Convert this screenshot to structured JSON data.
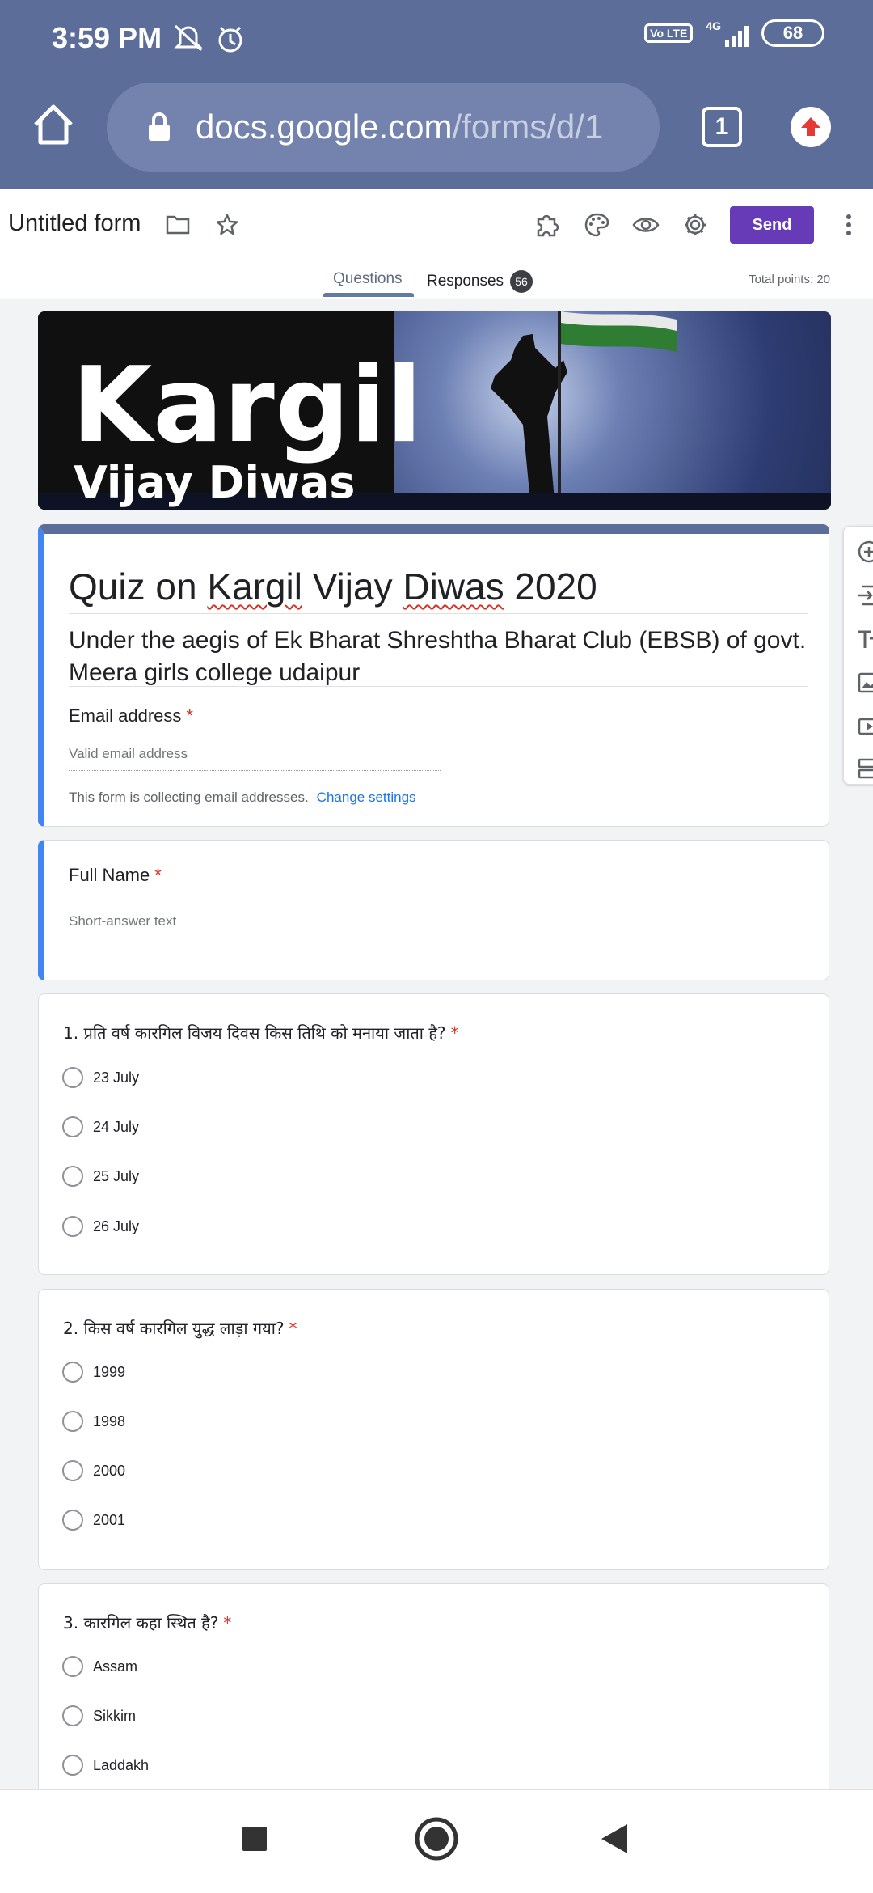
{
  "status": {
    "time": "3:59 PM",
    "network": "4G",
    "volte": "Vo LTE",
    "battery": "68"
  },
  "browser": {
    "url_host": "docs.google.com",
    "url_path": "/forms/d/1",
    "tab_count": "1"
  },
  "form_header": {
    "title": "Untitled form",
    "send_label": "Send",
    "tabs": [
      {
        "label": "Questions"
      },
      {
        "label": "Responses",
        "badge": "56"
      }
    ],
    "total_points": "Total points: 20"
  },
  "banner": {
    "title": "Kargil",
    "subtitle": "Vijay Diwas"
  },
  "form": {
    "title_parts": [
      "Quiz on ",
      "Kargil",
      " Vijay ",
      "Diwas",
      " 2020"
    ],
    "description": "Under the aegis of Ek Bharat Shreshtha Bharat Club (EBSB) of govt. Meera girls college udaipur",
    "email_label": "Email address",
    "email_placeholder": "Valid email address",
    "collect_note": "This form is collecting email addresses.",
    "change_settings": "Change settings",
    "required_mark": "*"
  },
  "questions": [
    {
      "label": "Full Name",
      "placeholder": "Short-answer text"
    },
    {
      "label": "1. प्रति वर्ष कारगिल विजय दिवस किस तिथि को मनाया जाता है?",
      "options": [
        "23 July",
        "24 July",
        "25 July",
        "26 July"
      ]
    },
    {
      "label": "2. किस वर्ष कारगिल युद्ध लाड़ा गया?",
      "options": [
        "1999",
        "1998",
        "2000",
        "2001"
      ]
    },
    {
      "label": "3. कारगिल कहा स्थित है?",
      "options": [
        "Assam",
        "Sikkim",
        "Laddakh"
      ]
    }
  ],
  "colors": {
    "chrome": "#5d6d99",
    "accent": "#673ab7",
    "active_border": "#4285f4",
    "required": "#d93025",
    "link": "#1a73e8"
  }
}
